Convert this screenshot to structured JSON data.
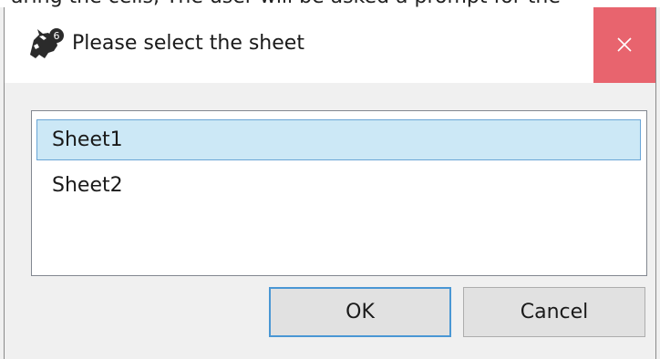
{
  "background_fragment": {
    "text": "aring the cells, The user will be asked a prompt for the"
  },
  "dialog": {
    "title": "Please select the sheet",
    "app_icon": "rhino-icon",
    "app_icon_badge": "6",
    "close_icon": "close-icon",
    "close_hover_color": "#e8646e",
    "sheets": [
      {
        "label": "Sheet1",
        "selected": true
      },
      {
        "label": "Sheet2",
        "selected": false
      }
    ],
    "ok_label": "OK",
    "cancel_label": "Cancel",
    "selection_color": "#cce8f6",
    "default_button_border": "#4a97d4"
  }
}
